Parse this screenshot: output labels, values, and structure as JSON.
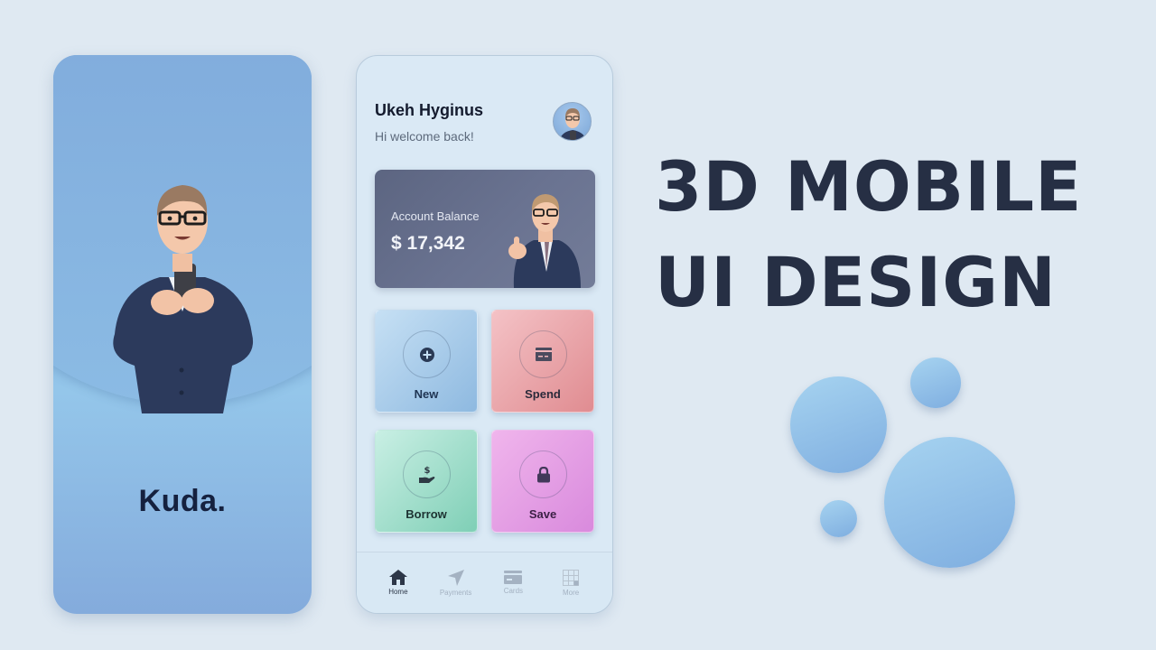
{
  "splash_screen": {
    "brand_name": "Kuda.",
    "illustration": "3d-man-with-phone"
  },
  "home_screen": {
    "user_name": "Ukeh Hyginus",
    "greeting": "Hi welcome back!",
    "avatar": "3d-man-avatar",
    "balance_card": {
      "label": "Account Balance",
      "value": "$ 17,342",
      "illustration": "3d-man-thumbs-up"
    },
    "actions": [
      {
        "label": "New",
        "icon": "plus-circle-icon",
        "color": "#9ec5e8"
      },
      {
        "label": "Spend",
        "icon": "credit-card-icon",
        "color": "#eaa5aa"
      },
      {
        "label": "Borrow",
        "icon": "hand-dollar-icon",
        "color": "#9fdcc8"
      },
      {
        "label": "Save",
        "icon": "lock-icon",
        "color": "#e49fe4"
      }
    ],
    "bottom_nav": [
      {
        "label": "Home",
        "icon": "home-icon",
        "active": true
      },
      {
        "label": "Payments",
        "icon": "send-arrow-icon",
        "active": false
      },
      {
        "label": "Cards",
        "icon": "card-icon",
        "active": false
      },
      {
        "label": "More",
        "icon": "grid-icon",
        "active": false
      }
    ]
  },
  "headline": {
    "line1": "3D MOBILE",
    "line2": "UI DESIGN"
  },
  "colors": {
    "background": "#dfe9f2",
    "headline": "#262f44",
    "bubble": "#8fbde6",
    "balance_card": "#646d8a"
  }
}
